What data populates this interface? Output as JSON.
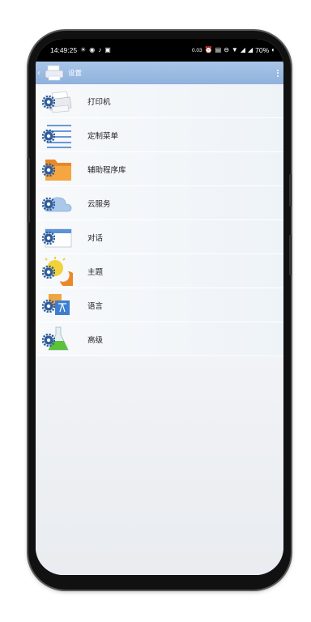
{
  "status_bar": {
    "time": "14:49:25",
    "battery": "70%",
    "net_speed": "0.03"
  },
  "app_bar": {
    "title": "设置"
  },
  "menu": {
    "items": [
      {
        "label": "打印机",
        "icon": "printer-icon"
      },
      {
        "label": "定制菜单",
        "icon": "menu-list-icon"
      },
      {
        "label": "辅助程序库",
        "icon": "folder-icon"
      },
      {
        "label": "云服务",
        "icon": "cloud-icon"
      },
      {
        "label": "对话",
        "icon": "dialog-window-icon"
      },
      {
        "label": "主题",
        "icon": "theme-icon"
      },
      {
        "label": "语言",
        "icon": "language-icon"
      },
      {
        "label": "高级",
        "icon": "flask-icon"
      }
    ]
  },
  "colors": {
    "app_bar": "#9dbbe2",
    "gear": "#2f5d9a"
  }
}
